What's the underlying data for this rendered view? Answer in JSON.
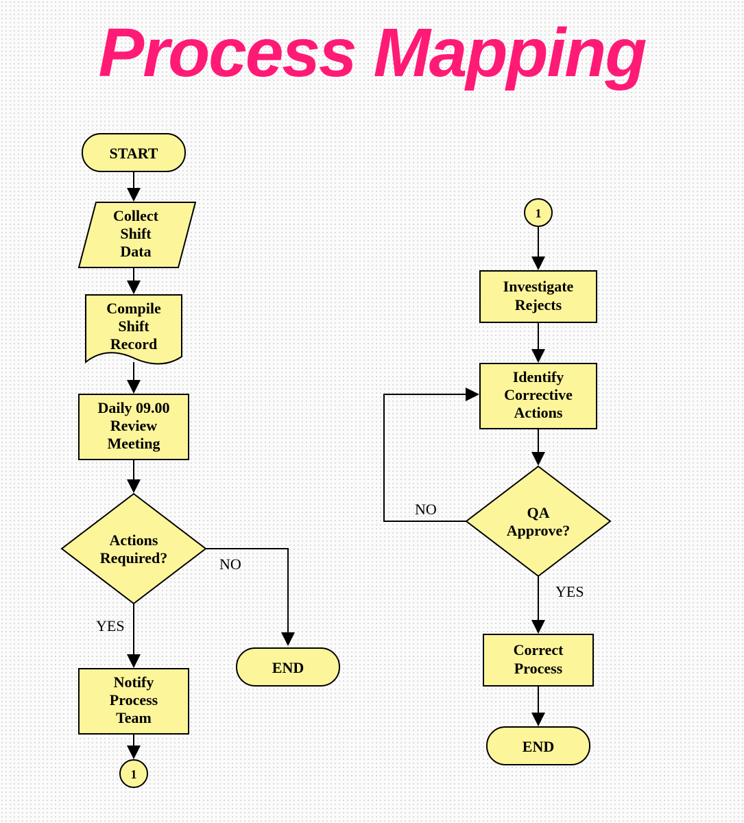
{
  "title": "Process Mapping",
  "nodes": {
    "start": "START",
    "collect": [
      "Collect",
      "Shift",
      "Data"
    ],
    "compile": [
      "Compile",
      "Shift",
      "Record"
    ],
    "review": [
      "Daily 09.00",
      "Review",
      "Meeting"
    ],
    "actions_q": [
      "Actions",
      "Required?"
    ],
    "notify": [
      "Notify",
      "Process",
      "Team"
    ],
    "conn1a": "1",
    "end1": "END",
    "conn1b": "1",
    "investigate": [
      "Investigate",
      "Rejects"
    ],
    "identify": [
      "Identify",
      "Corrective",
      "Actions"
    ],
    "qa_q": [
      "QA",
      "Approve?"
    ],
    "correct": [
      "Correct",
      "Process"
    ],
    "end2": "END"
  },
  "edges": {
    "yes": "YES",
    "no": "NO"
  },
  "colors": {
    "shape_fill": "#fdf59a",
    "stroke": "#000000",
    "title": "#ff1a75"
  }
}
